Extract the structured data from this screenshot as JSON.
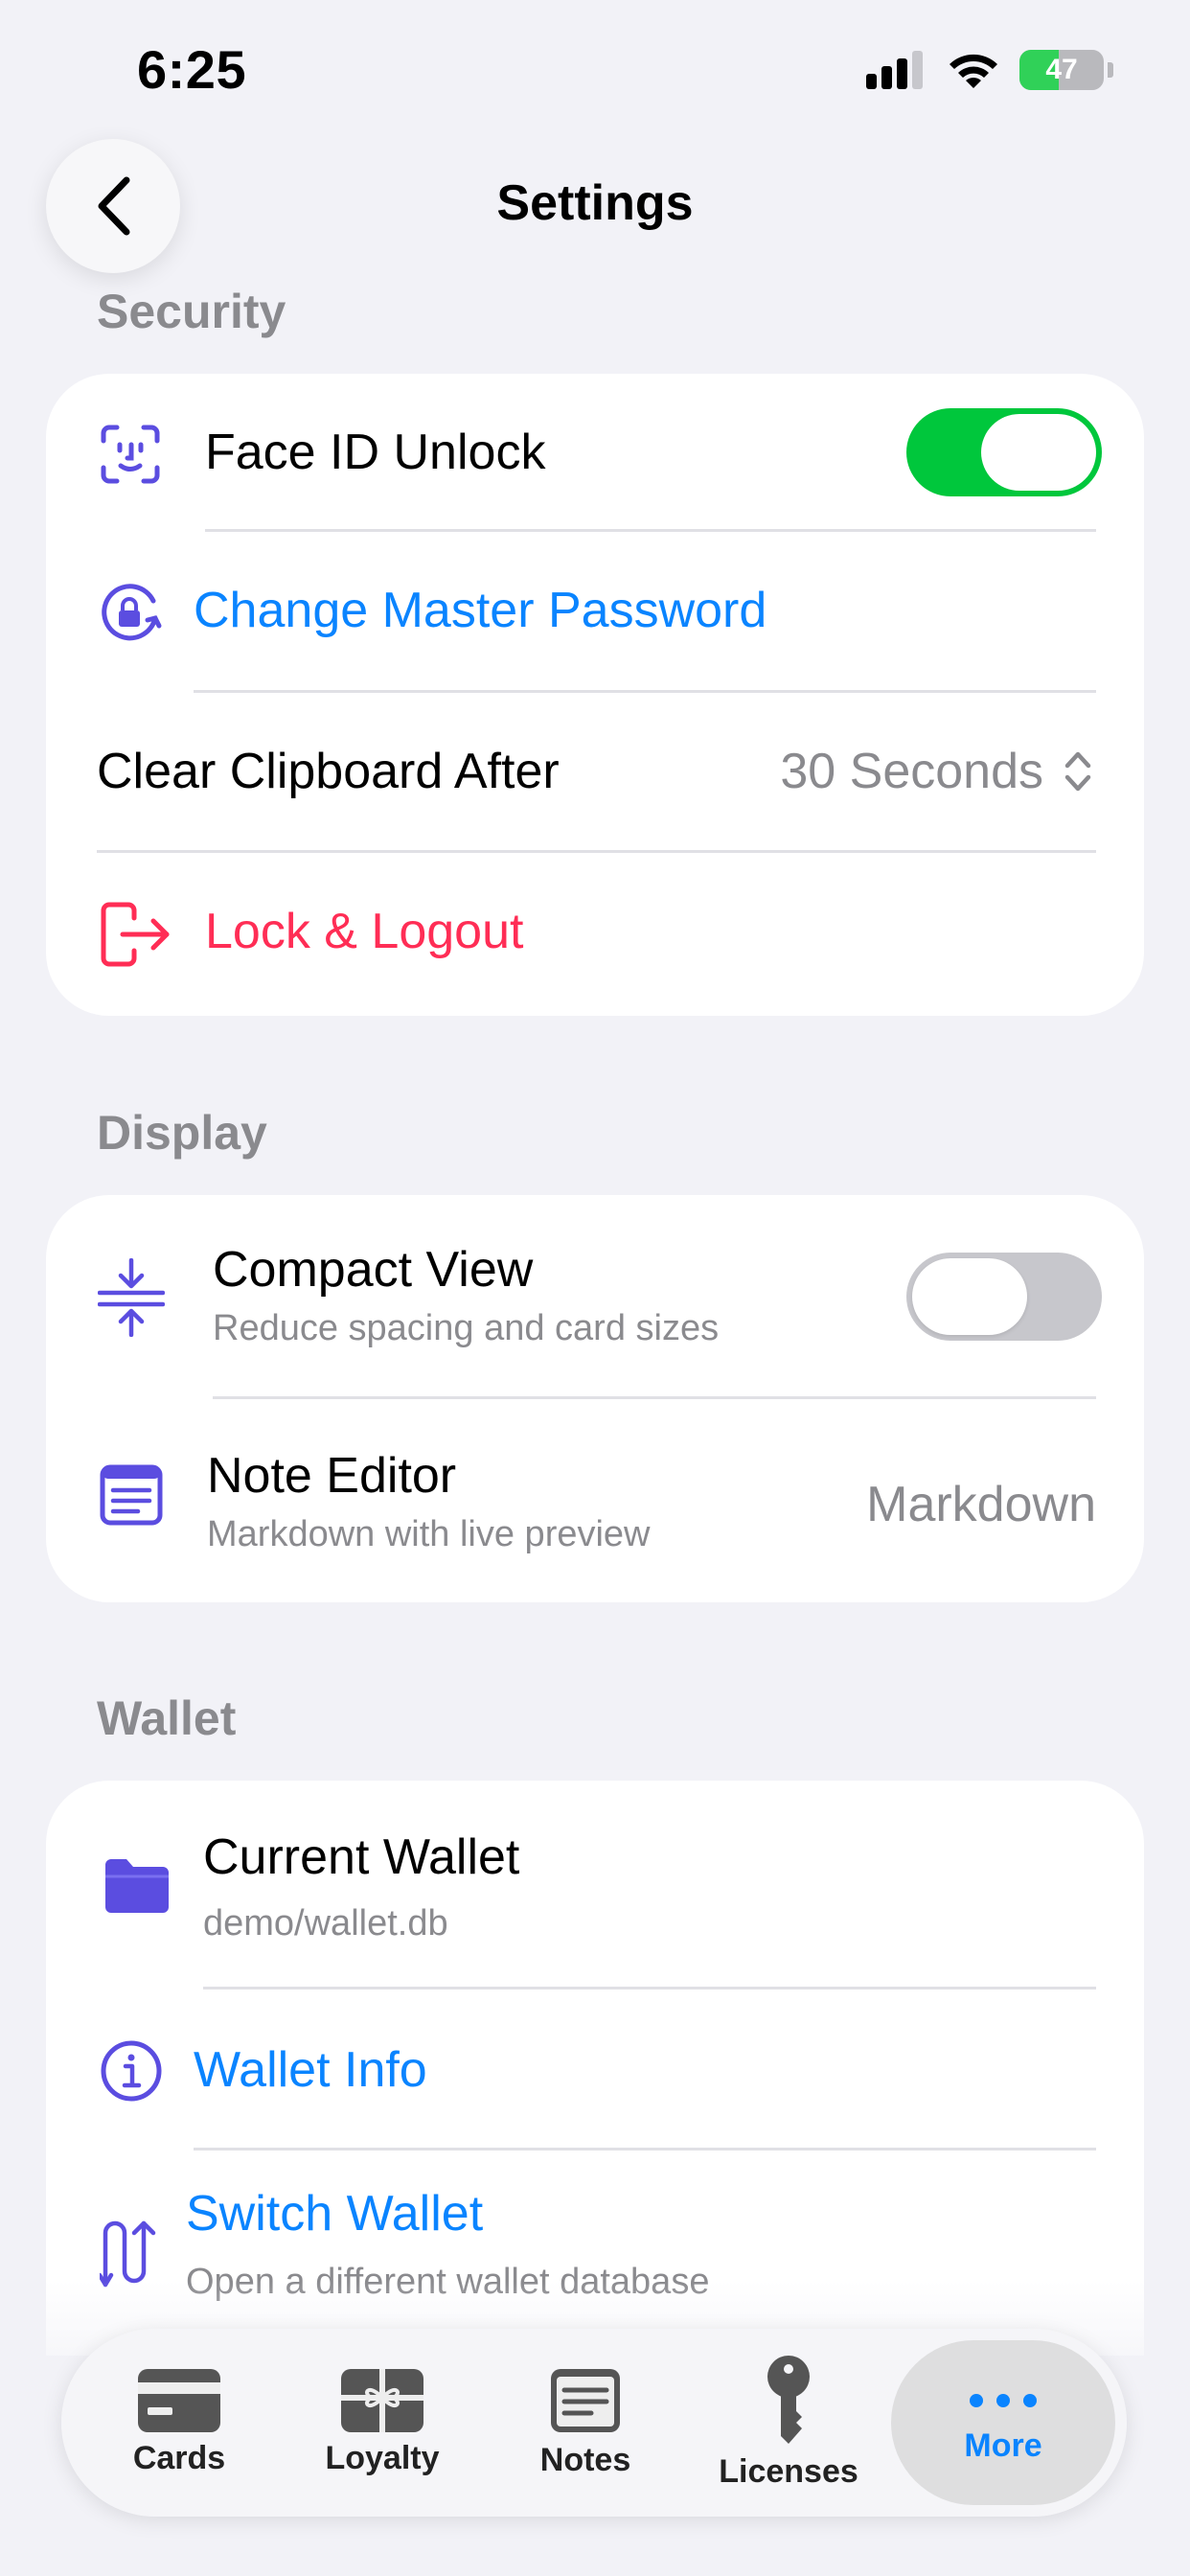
{
  "status_bar": {
    "time": "6:25",
    "battery": "47"
  },
  "nav": {
    "title": "Settings"
  },
  "security": {
    "header": "Security",
    "face_id_label": "Face ID Unlock",
    "face_id_enabled": true,
    "change_password_label": "Change Master Password",
    "clear_clipboard_label": "Clear Clipboard After",
    "clear_clipboard_value": "30 Seconds",
    "lock_logout_label": "Lock & Logout"
  },
  "display": {
    "header": "Display",
    "compact_label": "Compact View",
    "compact_sub": "Reduce spacing and card sizes",
    "compact_enabled": false,
    "note_editor_label": "Note Editor",
    "note_editor_sub": "Markdown with live preview",
    "note_editor_value": "Markdown"
  },
  "wallet": {
    "header": "Wallet",
    "current_label": "Current Wallet",
    "current_path": "demo/wallet.db",
    "info_label": "Wallet Info",
    "switch_label": "Switch Wallet",
    "switch_sub": "Open a different wallet database"
  },
  "tabs": [
    {
      "label": "Cards",
      "icon": "card-icon"
    },
    {
      "label": "Loyalty",
      "icon": "gift-icon"
    },
    {
      "label": "Notes",
      "icon": "note-icon"
    },
    {
      "label": "Licenses",
      "icon": "key-icon"
    },
    {
      "label": "More",
      "icon": "ellipsis-icon",
      "active": true
    }
  ],
  "colors": {
    "accent": "#0a84ff",
    "icon_purple": "#5b4de0",
    "danger": "#ff2d55",
    "toggle_on": "#00c73c",
    "background": "#f2f2f7"
  }
}
